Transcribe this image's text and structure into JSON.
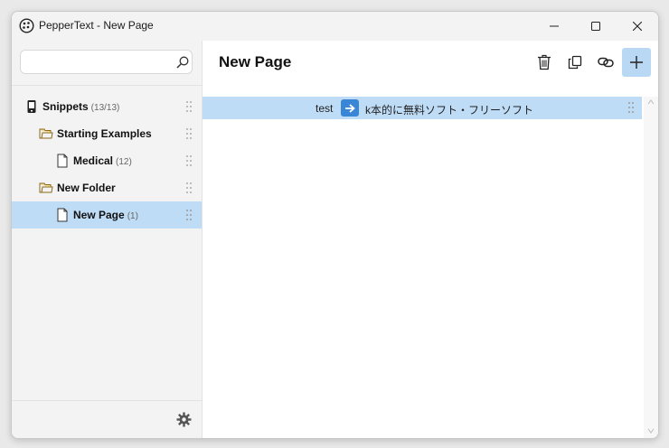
{
  "window": {
    "title": "PepperText - New Page"
  },
  "search": {
    "value": "",
    "placeholder": ""
  },
  "tree": [
    {
      "label": "Snippets",
      "count": "(13/13)",
      "icon": "phone-icon",
      "level": 0
    },
    {
      "label": "Starting Examples",
      "count": "",
      "icon": "folder-icon",
      "level": 1
    },
    {
      "label": "Medical",
      "count": "(12)",
      "icon": "page-icon",
      "level": 2
    },
    {
      "label": "New Folder",
      "count": "",
      "icon": "folder-icon",
      "level": 1
    },
    {
      "label": "New Page",
      "count": "(1)",
      "icon": "page-icon",
      "level": 2,
      "selected": true
    }
  ],
  "main": {
    "title": "New Page",
    "toolbar": [
      "trash-icon",
      "copy-icon",
      "link-icon",
      "plus-icon"
    ],
    "entries": [
      {
        "trigger": "test",
        "arrow_icon": "arrow-right-icon",
        "text": "k本的に無料ソフト・フリーソフト"
      }
    ]
  },
  "colors": {
    "selection": "#bfdcf6",
    "accent": "#3a86d6",
    "primary_button": "#b8d8f3"
  }
}
